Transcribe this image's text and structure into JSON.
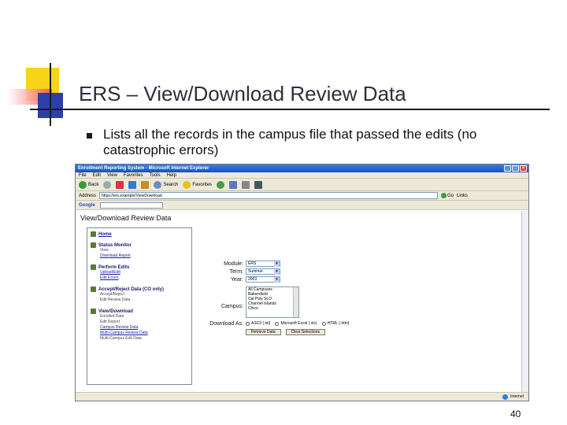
{
  "slide": {
    "title": "ERS – View/Download Review Data",
    "bullet": "Lists all the records in the campus file that passed the edits (no catastrophic errors)",
    "page_number": "40"
  },
  "browser": {
    "window_title": "Enrollment Reporting System - Microsoft Internet Explorer",
    "menu": [
      "File",
      "Edit",
      "View",
      "Favorites",
      "Tools",
      "Help"
    ],
    "toolbar": {
      "back": "Back",
      "search": "Search",
      "favorites": "Favorites"
    },
    "address_label": "Address",
    "address_value": "https://ers.example/ViewDownload",
    "go_label": "Go",
    "links_label": "Links",
    "google_label": "Google",
    "status_text": "Internet"
  },
  "page": {
    "heading": "View/Download Review Data",
    "nav": [
      {
        "head": "Home",
        "items": []
      },
      {
        "head": "Status Monitor",
        "items": [
          "View",
          "Download Report"
        ]
      },
      {
        "head": "Perform Edits",
        "items": [
          "Upload/Edit",
          "Edit Errors"
        ]
      },
      {
        "head": "Accept/Reject Data (CO only)",
        "items": [
          "Accept/Reject",
          "Edit Review Data"
        ]
      },
      {
        "head": "View/Download",
        "items": [
          "Enrolled Data",
          "Edit Report",
          "Campus Review Data",
          "Multi-Campus Review Data",
          "Multi-Campus Edit Data"
        ]
      }
    ],
    "form": {
      "module_label": "Module:",
      "module_value": "ERS",
      "term_label": "Term:",
      "term_value": "Summer",
      "year_label": "Year:",
      "year_value": "2003",
      "campus_label": "Campus:",
      "campus_options": [
        "All Campuses",
        "Bakersfield",
        "Cal Poly SLO",
        "Channel Islands",
        "Chico"
      ],
      "download_label": "Download As:",
      "download_options": [
        "ASCII (.txt)",
        "Microsoft Excel (.xls)",
        "HTML (.htm)"
      ],
      "buttons": [
        "Retrieve Data",
        "Clear Selections"
      ]
    }
  },
  "colors": {
    "deco_yellow": "#f7d417",
    "deco_blue": "#2c3ea8",
    "deco_red": "#f04a4a",
    "xp_title": "#1a4fc4"
  }
}
